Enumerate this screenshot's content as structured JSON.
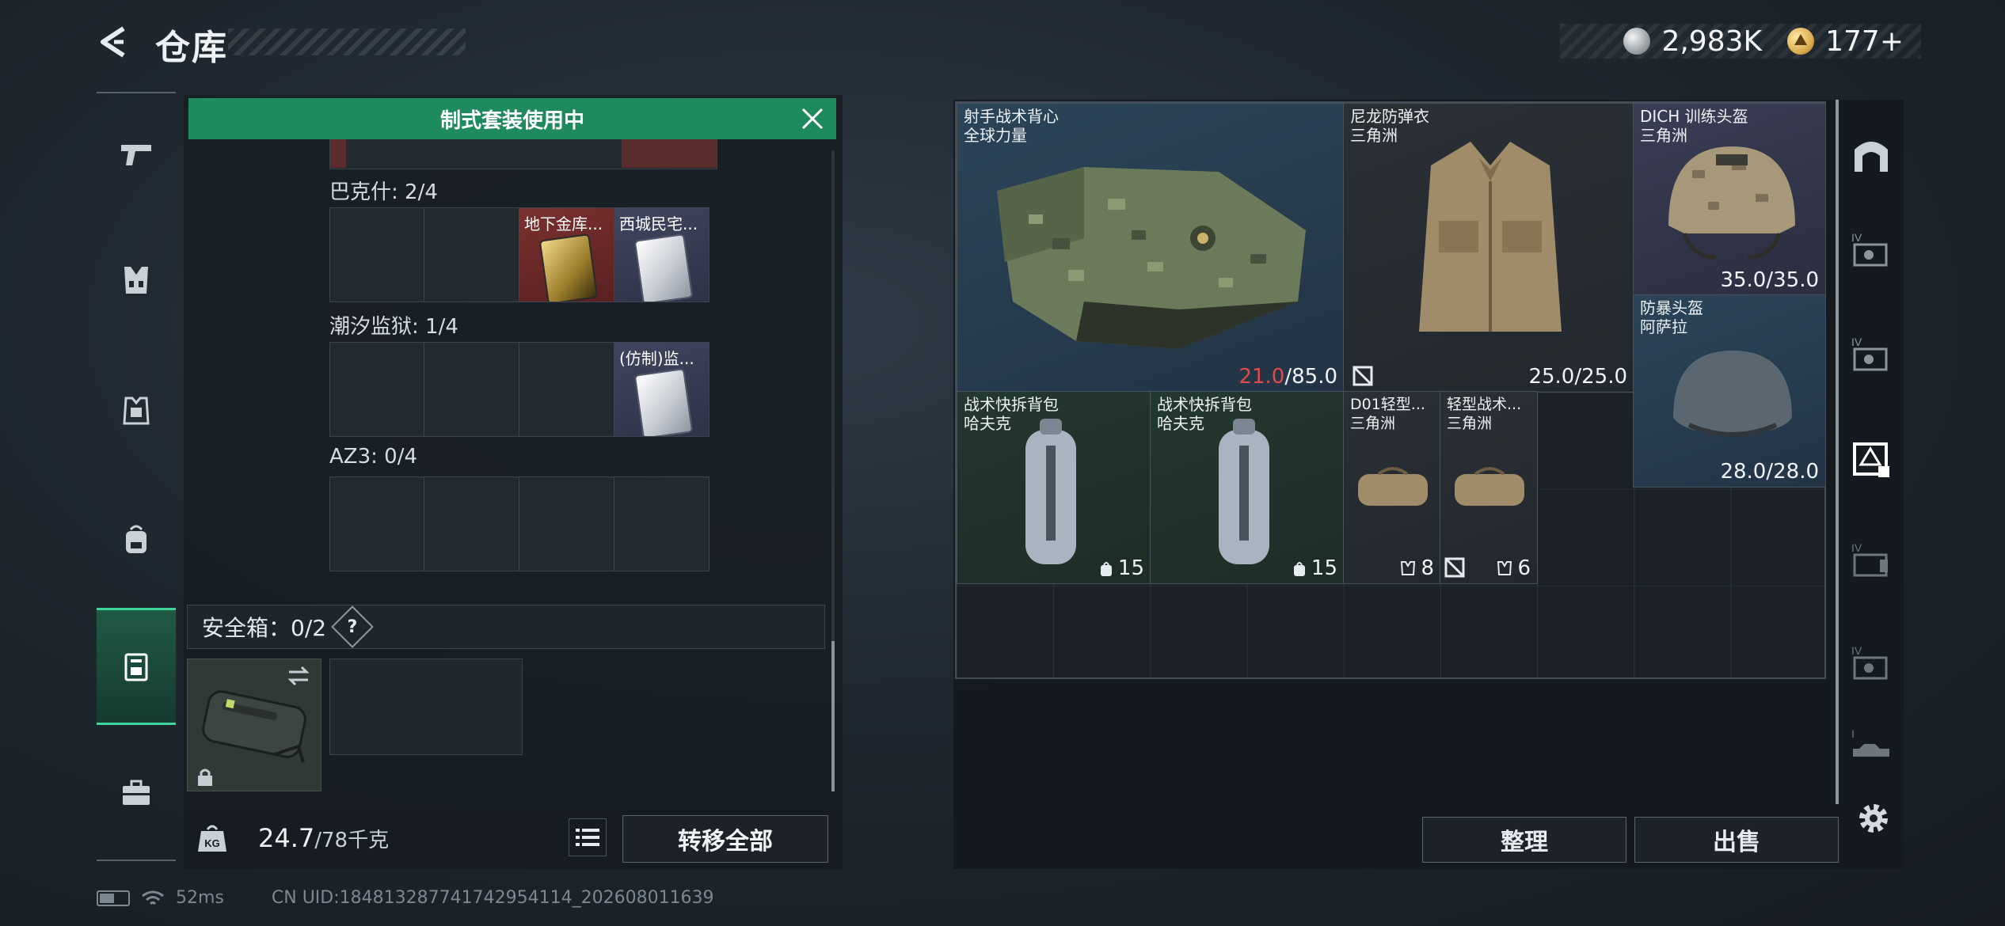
{
  "header": {
    "title": "仓库",
    "currencies": [
      {
        "icon": "silver-coin-icon",
        "value": "2,983K"
      },
      {
        "icon": "gold-coin-icon",
        "value": "177+"
      }
    ]
  },
  "left_nav": {
    "items": [
      {
        "icon": "pistol-icon"
      },
      {
        "icon": "vest-icon"
      },
      {
        "icon": "armor-icon"
      },
      {
        "icon": "backpack-icon"
      },
      {
        "icon": "case-icon",
        "active": true
      },
      {
        "icon": "toolbox-icon"
      }
    ]
  },
  "storage": {
    "banner": "制式套装使用中",
    "groups": [
      {
        "label": "巴克什: 2/4",
        "slots": [
          "",
          "",
          "地下金库...",
          "西城民宅..."
        ]
      },
      {
        "label": "潮汐监狱: 1/4",
        "slots": [
          "",
          "",
          "",
          "(仿制)监..."
        ]
      },
      {
        "label": "AZ3: 0/4",
        "slots": [
          "",
          "",
          "",
          ""
        ]
      }
    ],
    "safebox": {
      "label": "安全箱：0/2",
      "help": "?"
    },
    "weight": {
      "current": "24.7",
      "max": "/78千克"
    },
    "transfer_all": "转移全部"
  },
  "equipment": {
    "items": [
      {
        "name1": "射手战术背心",
        "name2": "全球力量",
        "dur_current": "21.0",
        "dur_max": "/85.0"
      },
      {
        "name1": "尼龙防弹衣",
        "name2": "三角洲",
        "durability": "25.0/25.0"
      },
      {
        "name1": "DICH 训练头盔",
        "name2": "三角洲",
        "durability": "35.0/35.0"
      },
      {
        "name1": "防暴头盔",
        "name2": "阿萨拉",
        "durability": "28.0/28.0"
      },
      {
        "name1": "战术快拆背包",
        "name2": "哈夫克",
        "count": "15"
      },
      {
        "name1": "战术快拆背包",
        "name2": "哈夫克",
        "count": "15"
      },
      {
        "name1": "D01轻型...",
        "name2": "三角洲",
        "count": "8"
      },
      {
        "name1": "轻型战术...",
        "name2": "三角洲",
        "count": "6"
      }
    ],
    "organize": "整理",
    "sell": "出售"
  },
  "status": {
    "ping": "52ms",
    "uid": "CN UID:18481328774174295411 4_202608011639"
  },
  "status_uid": "CN UID:184813287741742954114_202608011639",
  "colors": {
    "accent_green": "#1f8a5e",
    "durability_low": "#e24b4b"
  }
}
